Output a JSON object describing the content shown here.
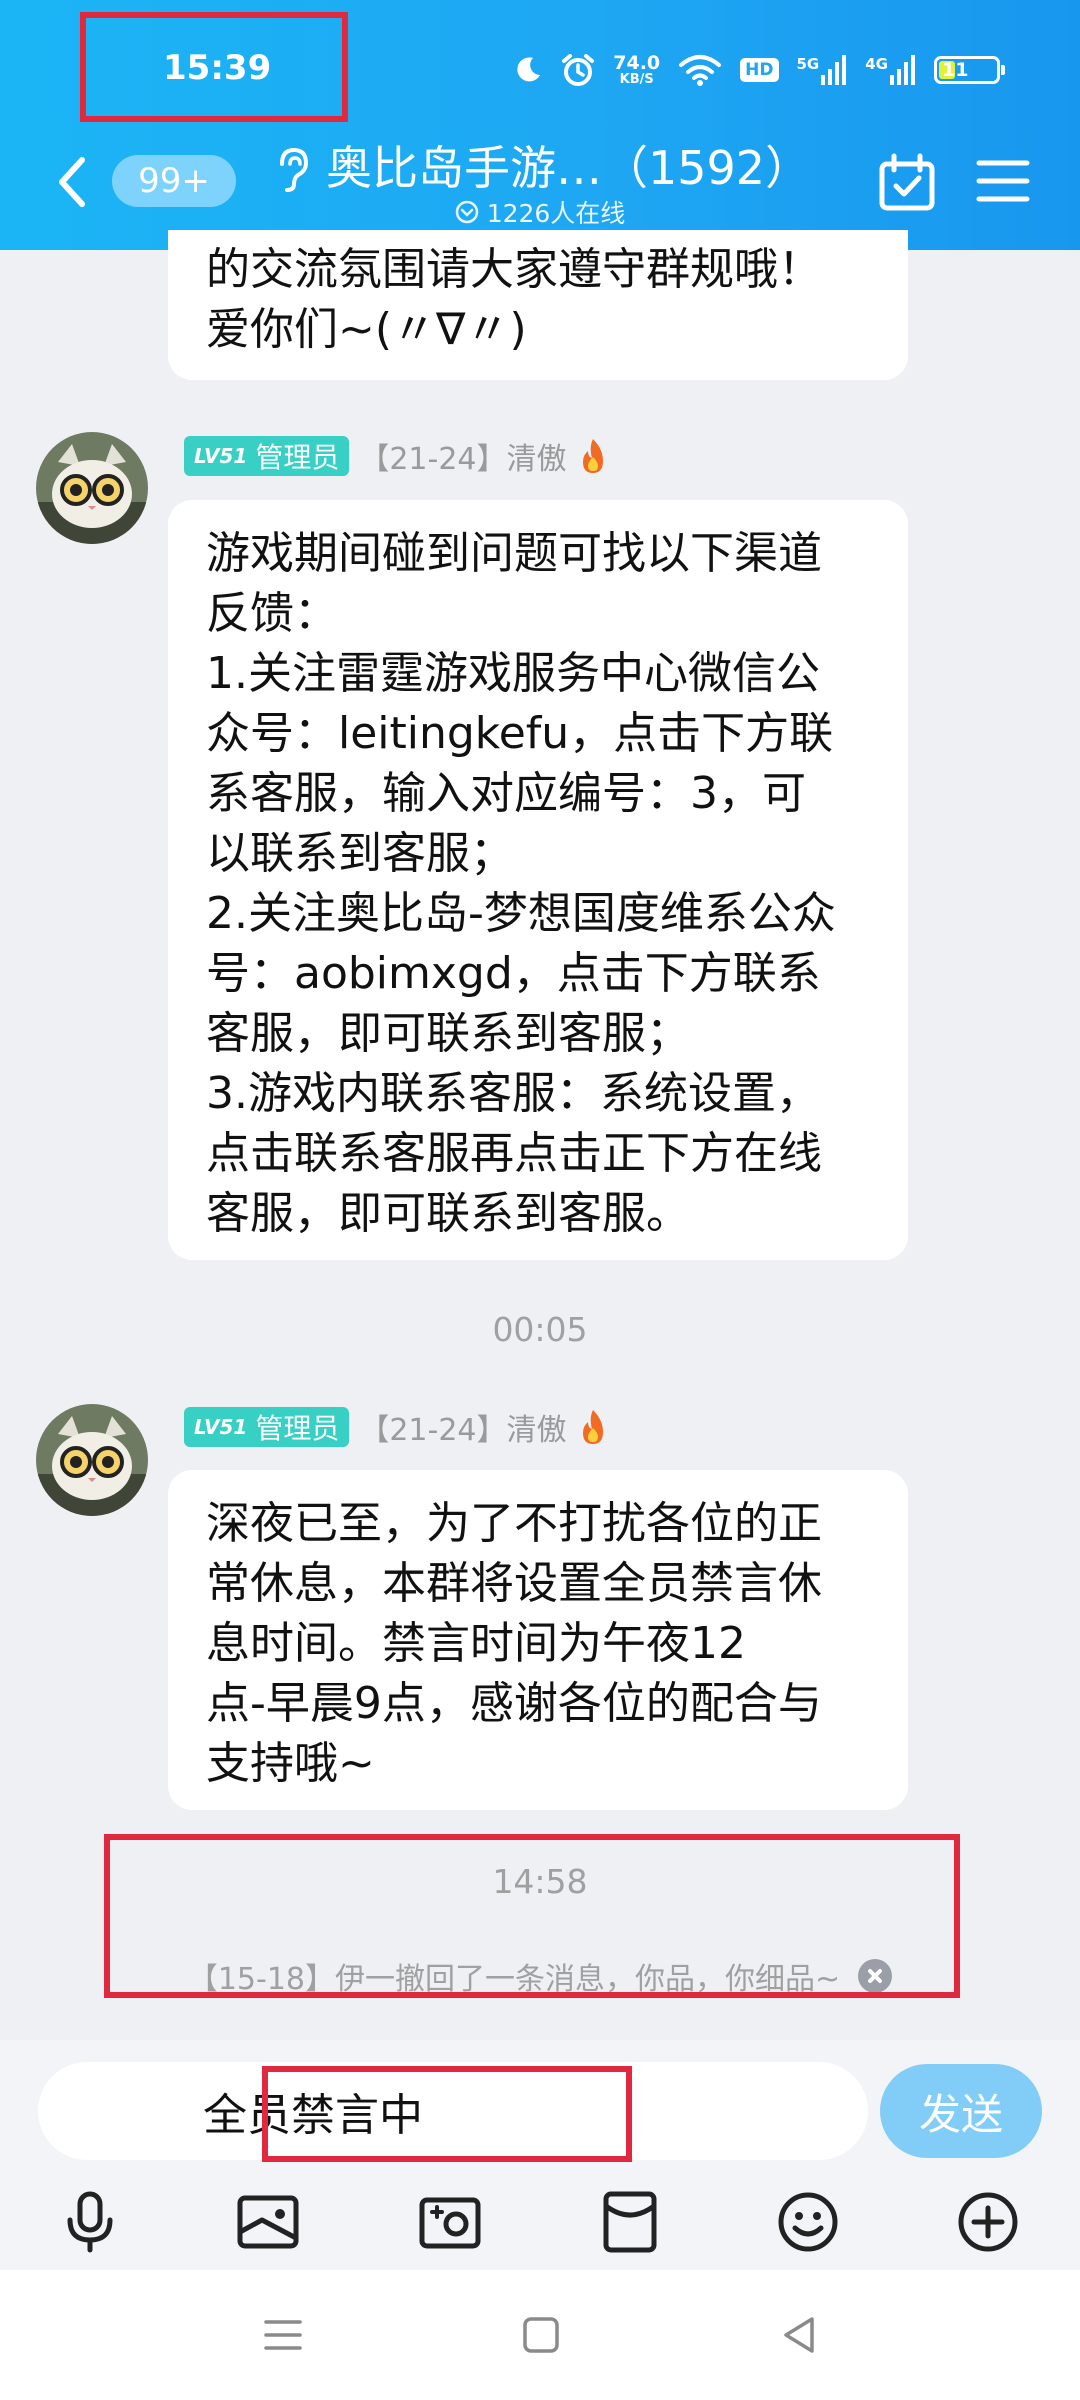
{
  "status_bar": {
    "time": "15:39",
    "net_speed": "74.0",
    "net_speed_unit": "KB/S",
    "hd_label": "HD",
    "net1": "5G",
    "net2": "4G",
    "battery": "11",
    "icons": [
      "moon-icon",
      "alarm-icon",
      "wifi-icon",
      "signal-icon",
      "battery-icon"
    ]
  },
  "header": {
    "unread_badge": "99+",
    "title": "奥比岛手游…（1592）",
    "online_count": "1226人在线",
    "icons": [
      "back-icon",
      "ear-icon",
      "calendar-check-icon",
      "menu-icon"
    ]
  },
  "messages": {
    "top_partial": {
      "lines": [
        "的交流氛围请大家遵守群规哦！",
        "爱你们~(〃∇〃)"
      ]
    },
    "msg1": {
      "level": "LV51",
      "role": "管理员",
      "sender": "【21-24】清傲",
      "lines": [
        "游戏期间碰到问题可找以下渠道",
        "反馈：",
        "1.关注雷霆游戏服务中心微信公",
        "众号：leitingkefu，点击下方联",
        "系客服，输入对应编号：3，可",
        "以联系到客服；",
        "2.关注奥比岛-梦想国度维系公众",
        "号：aobimxgd，点击下方联系",
        "客服，即可联系到客服；",
        "3.游戏内联系客服：系统设置，",
        "点击联系客服再点击正下方在线",
        "客服，即可联系到客服。"
      ]
    },
    "time1": "00:05",
    "msg2": {
      "level": "LV51",
      "role": "管理员",
      "sender": "【21-24】清傲",
      "lines": [
        "深夜已至，为了不打扰各位的正",
        "常休息，本群将设置全员禁言休",
        "息时间。禁言时间为午夜12",
        "点-早晨9点，感谢各位的配合与",
        "支持哦~"
      ]
    },
    "time2": "14:58",
    "recall_notice": "【15-18】伊一撤回了一条消息，你品，你细品~"
  },
  "input": {
    "muted_text": "全员禁言中",
    "send_label": "发送",
    "toolbar": [
      "microphone-icon",
      "image-icon",
      "camera-icon",
      "red-packet-icon",
      "emoji-icon",
      "plus-icon"
    ]
  },
  "nav": [
    "recent-apps-icon",
    "home-icon",
    "back-nav-icon"
  ],
  "colors": {
    "header_blue": "#1ea7f3",
    "badge_teal": "#38d0c4",
    "send_button": "#82ccf8",
    "annotation_red": "#e0283f"
  }
}
